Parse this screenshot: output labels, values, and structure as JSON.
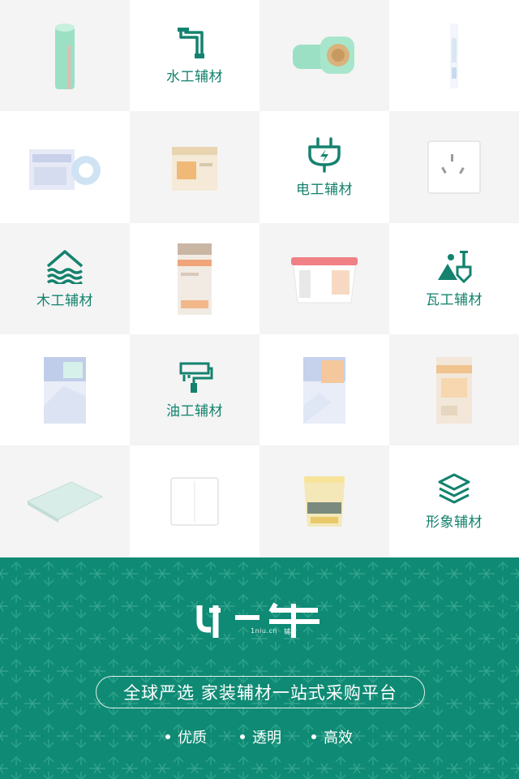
{
  "categories": {
    "water": "水工辅材",
    "electric": "电工辅材",
    "wood": "木工辅材",
    "tile": "瓦工辅材",
    "paint": "油工辅材",
    "decor": "形象辅材"
  },
  "brand": {
    "name": "一牛",
    "domain": "1niu.cn",
    "tag": "辅材"
  },
  "slogan": "全球严选  家装辅材一站式采购平台",
  "features": [
    "优质",
    "透明",
    "高效"
  ],
  "colors": {
    "brand_green": "#0f8a74",
    "label_green": "#14826e",
    "cell_gray": "#f4f4f4"
  }
}
